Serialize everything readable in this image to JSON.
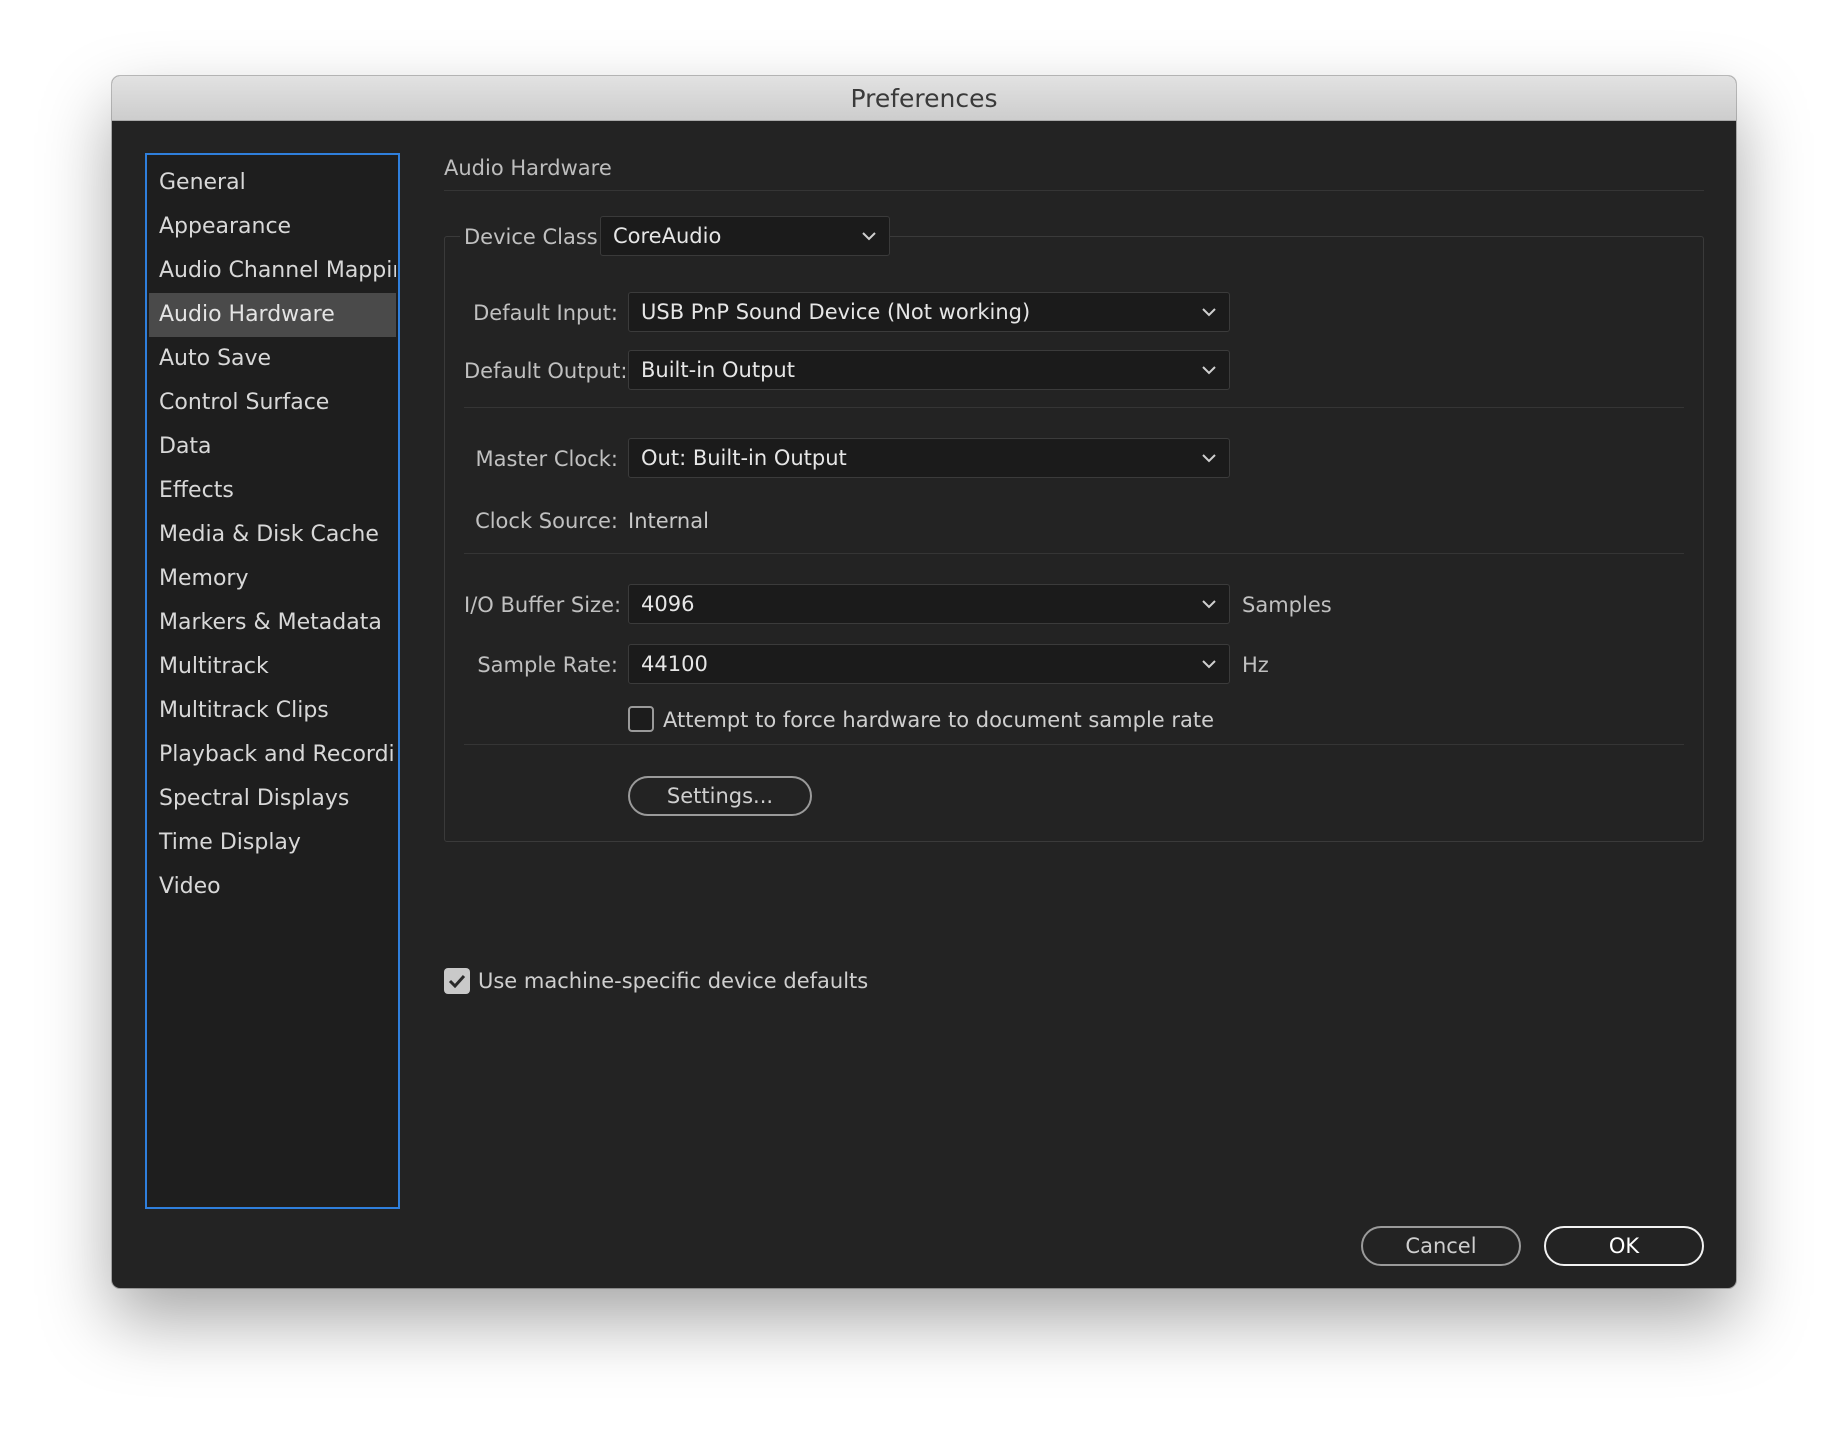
{
  "window": {
    "title": "Preferences"
  },
  "sidebar": {
    "items": [
      {
        "label": "General"
      },
      {
        "label": "Appearance"
      },
      {
        "label": "Audio Channel Mapping"
      },
      {
        "label": "Audio Hardware",
        "selected": true
      },
      {
        "label": "Auto Save"
      },
      {
        "label": "Control Surface"
      },
      {
        "label": "Data"
      },
      {
        "label": "Effects"
      },
      {
        "label": "Media & Disk Cache"
      },
      {
        "label": "Memory"
      },
      {
        "label": "Markers & Metadata"
      },
      {
        "label": "Multitrack"
      },
      {
        "label": "Multitrack Clips"
      },
      {
        "label": "Playback and Recording"
      },
      {
        "label": "Spectral Displays"
      },
      {
        "label": "Time Display"
      },
      {
        "label": "Video"
      }
    ]
  },
  "panel": {
    "section_title": "Audio Hardware",
    "device_class": {
      "label": "Device Class:",
      "value": "CoreAudio"
    },
    "default_input": {
      "label": "Default Input:",
      "value": "USB PnP Sound Device (Not working)"
    },
    "default_output": {
      "label": "Default Output:",
      "value": "Built-in Output"
    },
    "master_clock": {
      "label": "Master Clock:",
      "value": "Out: Built-in Output"
    },
    "clock_source": {
      "label": "Clock Source:",
      "value": "Internal"
    },
    "io_buffer_size": {
      "label": "I/O Buffer Size:",
      "value": "4096",
      "unit": "Samples"
    },
    "sample_rate": {
      "label": "Sample Rate:",
      "value": "44100",
      "unit": "Hz"
    },
    "force_sample_rate": {
      "label": "Attempt to force hardware to document sample rate",
      "checked": false
    },
    "settings_button": "Settings...",
    "machine_defaults": {
      "label": "Use machine-specific device defaults",
      "checked": true
    }
  },
  "footer": {
    "cancel_label": "Cancel",
    "ok_label": "OK"
  },
  "icons": {
    "dropdown": "chevron-down-icon",
    "check": "checkmark-icon"
  },
  "colors": {
    "selection_border": "#2f7fdc",
    "window_bg": "#232323",
    "selected_item_bg": "#4a4a4a"
  }
}
